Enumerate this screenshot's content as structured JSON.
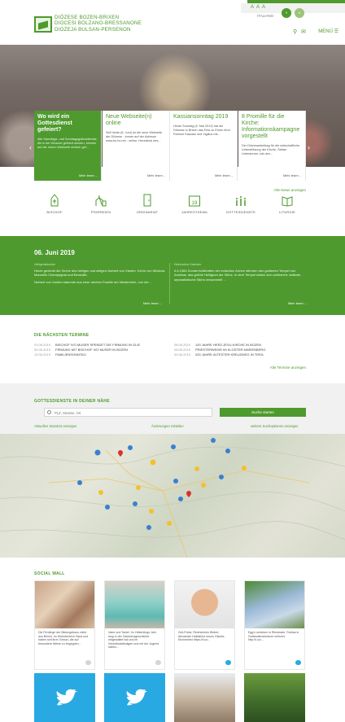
{
  "brand": {
    "line1": "DIÖZESE BOZEN-BRIXEN",
    "line2": "DIOCESI BOLZANO-BRESSANONE",
    "line3": "DIOZEJA BULSAN-PERSENON"
  },
  "header": {
    "font_size_label": "A A A",
    "language": "ITALIANO",
    "menu_label": "MENÜ"
  },
  "news": [
    {
      "title": "Wo wird ein Gottesdienst gefeiert?",
      "text": "Alle Samstags- und Sonntagsgottesdienste, die in der Diözese gefeiert werden, können auf der neuen Webseite einfach gef...",
      "more": "Mehr lesen ..."
    },
    {
      "title": "Neue Webseite(n) online",
      "text": "Seit heute (6. Juni) ist die neue Webseite der Diözese - immer auf der Adresse www.bz-bx.net - online. Herzstück des...",
      "more": "Mehr lesen ..."
    },
    {
      "title": "Kassiansonntag 2019",
      "text": "Heute Sonntag (5. Mai 2019) hat die Diözese in Brixen das Fest zu Ehren ihrer Patrone Kassian und Vigilius mit...",
      "more": "Mehr lesen ..."
    },
    {
      "title": "8 Promille für die Kirche: Informationskampagne vorgestellt",
      "text": "Der Diözesanbeitrag für die wirtschaftliche Unterstützung der Kirche, Stefan Unterdurner, hat den...",
      "more": "Mehr lesen ..."
    }
  ],
  "all_news_link": "Alle News anzeigen",
  "quick_links": [
    {
      "label": "BISCHOF",
      "icon": "bishop-icon"
    },
    {
      "label": "PFARREIEN",
      "icon": "church-icon"
    },
    {
      "label": "ORDINARIAT",
      "icon": "door-icon"
    },
    {
      "label": "JAHRESTHEMA",
      "icon": "calendar-icon"
    },
    {
      "label": "GOTTESDIENSTE",
      "icon": "candles-icon"
    },
    {
      "label": "LITURGIE",
      "icon": "book-icon"
    }
  ],
  "daily": {
    "date": "06. Juni 2019",
    "left_tag": "Heiligenkalender",
    "left_text": "Heute gedenkt die Kirche des heiligen und seligen Norbert von Xanten, Kevin von Wicklow, Marcellin Champagnat und Benedikt.",
    "left_text2": "Norbert von Xanten stammte aus einer reichen Familie am Niederrhein, von der ...",
    "left_more": "Mehr lesen ...",
    "right_tag": "Historischer Kalender",
    "right_text": "6.6.1984 Sonderrichtkraften der indischen Armee stürmen den goldenen Tempel von Amritsar, das größte Heiligtum der Sikhs. In dem Tempel hatten sich zahlreiche radikale, separatistische Sikhs versammelt ...",
    "right_more": "Mehr lesen ..."
  },
  "upcoming": {
    "heading": "DIE NÄCHSTEN TERMINE",
    "left": [
      {
        "date": "03.06.2019",
        "text": "BISCHOF IVO MUSER SPENDET DIE FIRMUNG IN GLIE"
      },
      {
        "date": "06.06.2019",
        "text": "FIRMUNG MIT BISCHOF IVO MUSER IN BOZEN"
      },
      {
        "date": "10.06.2019",
        "text": "FAMILIENSONNTAG"
      }
    ],
    "right": [
      {
        "date": "08.06.2019",
        "text": "100 JAHRE HERZ-JESU-KIRCHE IN BOZEN"
      },
      {
        "date": "08.06.2019",
        "text": "PRIESTERWEIHE IM KLOSTER MARIENBERG"
      },
      {
        "date": "09.06.2019",
        "text": "200 JAHRE ÄLTESTER KREUZWEG IN TIROL"
      }
    ],
    "all_link": "Alle Termine anzeigen"
  },
  "mass_search": {
    "heading": "GOTTESDIENSTE IN DEINER NÄHE",
    "placeholder": "PLZ, Strasse, Ort",
    "button": "Suche starten",
    "current_location": "Aktuellen Standort anzeigen",
    "report_changes": "Änderungen mitteilen",
    "more_search": "weitere Suchoptionen anzeigen"
  },
  "social": {
    "heading": "SOCIAL WALL",
    "posts": [
      {
        "text": "Die Firmlinge der Bildungshaus vieler aus Brixen, im Wohnbereich Haus und haben seit ihrer Geburt, die auf besondere Weise zu begegnen..."
      },
      {
        "text": "Vater und Tante!, Im Heiterkings Jahr lang in der Glaubensgeschichte mitgestaltet hat und im Verselbstständigen und mit der Jugend haben..."
      },
      {
        "text": "Zeit-Priest. Reicheiches Bildes! Alexander Halbsfuhs neues Glaube, Kirchenlied https://t.co/..."
      },
      {
        "text": "Egg'n schicken in Rimstrade. Ruthas in Gottesdienstmanne mehrere http://t.co/..."
      }
    ]
  },
  "colors": {
    "brand_green": "#4e9a2e",
    "twitter_blue": "#29a9e1"
  }
}
